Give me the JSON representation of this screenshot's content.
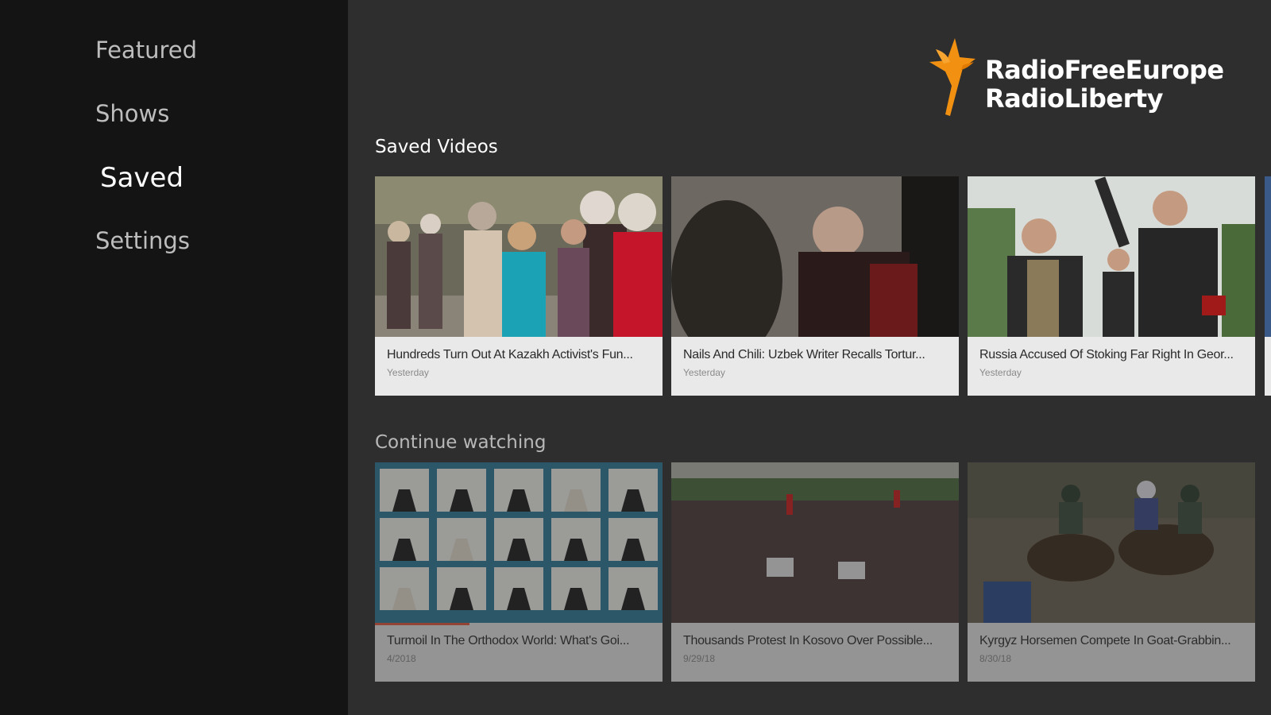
{
  "nav": {
    "items": [
      {
        "label": "Featured",
        "active": false
      },
      {
        "label": "Shows",
        "active": false
      },
      {
        "label": "Saved",
        "active": true
      },
      {
        "label": "Settings",
        "active": false
      }
    ]
  },
  "brand": {
    "line1": "RadioFreeEurope",
    "line2": "RadioLiberty",
    "accent": "#f29111"
  },
  "saved": {
    "title": "Saved Videos",
    "cards": [
      {
        "title": "Hundreds Turn Out At Kazakh Activist's Fun...",
        "date": "Yesterday"
      },
      {
        "title": "Nails And Chili: Uzbek Writer Recalls Tortur...",
        "date": "Yesterday"
      },
      {
        "title": "Russia Accused Of Stoking Far Right In Geor...",
        "date": "Yesterday"
      }
    ]
  },
  "continue": {
    "title": "Continue watching",
    "cards": [
      {
        "title": "Turmoil In The Orthodox World: What's Goi...",
        "date": "4/2018",
        "progress": 0.33
      },
      {
        "title": "Thousands Protest In Kosovo Over Possible...",
        "date": "9/29/18",
        "progress": 0
      },
      {
        "title": "Kyrgyz Horsemen Compete In Goat-Grabbin...",
        "date": "8/30/18",
        "progress": 0
      }
    ]
  }
}
